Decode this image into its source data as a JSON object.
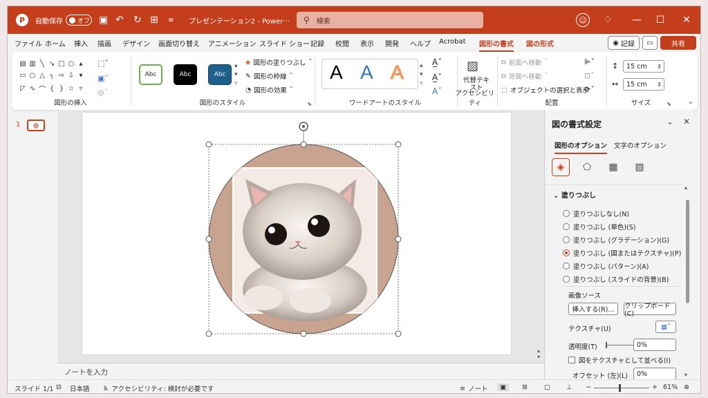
{
  "titlebar": {
    "logo": "P",
    "autosave_label": "自動保存",
    "autosave_state": "オフ",
    "doc_title": "プレゼンテーション2 - Power···",
    "search_placeholder": "検索",
    "icons": [
      "save-icon",
      "undo-icon",
      "redo-icon",
      "present-icon",
      "customize-icon"
    ]
  },
  "tabs": [
    "ファイル",
    "ホーム",
    "挿入",
    "描画",
    "デザイン",
    "画面切り替え",
    "アニメーション",
    "スライド ショー",
    "記録",
    "校閲",
    "表示",
    "開発",
    "ヘルプ",
    "Acrobat",
    "図形の書式",
    "図の形式"
  ],
  "tab_actions": {
    "record": "記録",
    "share": "共有"
  },
  "ribbon": {
    "groups": {
      "insert_shapes": "図形の挿入",
      "shape_styles": "図形のスタイル",
      "wordart_styles": "ワードアートのスタイル",
      "accessibility": "アクセシビリティ",
      "arrange": "配置",
      "size": "サイズ"
    },
    "style_samples": [
      "Abc",
      "Abc",
      "Abc"
    ],
    "shape_fill": "図形の塗りつぶし",
    "shape_outline": "図形の枠線",
    "shape_effects": "図形の効果",
    "wordart": [
      "A",
      "A",
      "A"
    ],
    "alt_text": "代替テキスト",
    "bring_forward": "前面へ移動",
    "send_backward": "背面へ移動",
    "selection_pane": "オブジェクトの選択と表示",
    "height": "15 cm",
    "width": "15 cm"
  },
  "thumbnails": {
    "slide_number": "1"
  },
  "notes_placeholder": "ノートを入力",
  "pane": {
    "title": "図の書式設定",
    "tabs": [
      "図形のオプション",
      "文字のオプション"
    ],
    "section": "塗りつぶし",
    "fill_options": [
      "塗りつぶしなし(N)",
      "塗りつぶし (単色)(S)",
      "塗りつぶし (グラデーション)(G)",
      "塗りつぶし (図またはテクスチャ)(P)",
      "塗りつぶし (パターン)(A)",
      "塗りつぶし (スライドの背景)(B)"
    ],
    "selected_fill_index": 3,
    "image_source": "画像ソース",
    "insert_button": "挿入する(R)...",
    "clipboard_button": "クリップボード(C)",
    "texture": "テクスチャ(U)",
    "transparency": "透明度(T)",
    "transparency_value": "0%",
    "tile_checkbox": "図をテクスチャとして並べる(I)",
    "offset_left": "オフセット (左)(L)",
    "offset_value": "0%"
  },
  "status": {
    "slide": "スライド 1/1",
    "language": "日本語",
    "accessibility": "アクセシビリティ: 検討が必要です",
    "notes": "ノート",
    "zoom": "61%",
    "zoom_fraction": 0.61
  },
  "colors": {
    "accent": "#c43e1c",
    "circle_fill": "#c7a390"
  }
}
